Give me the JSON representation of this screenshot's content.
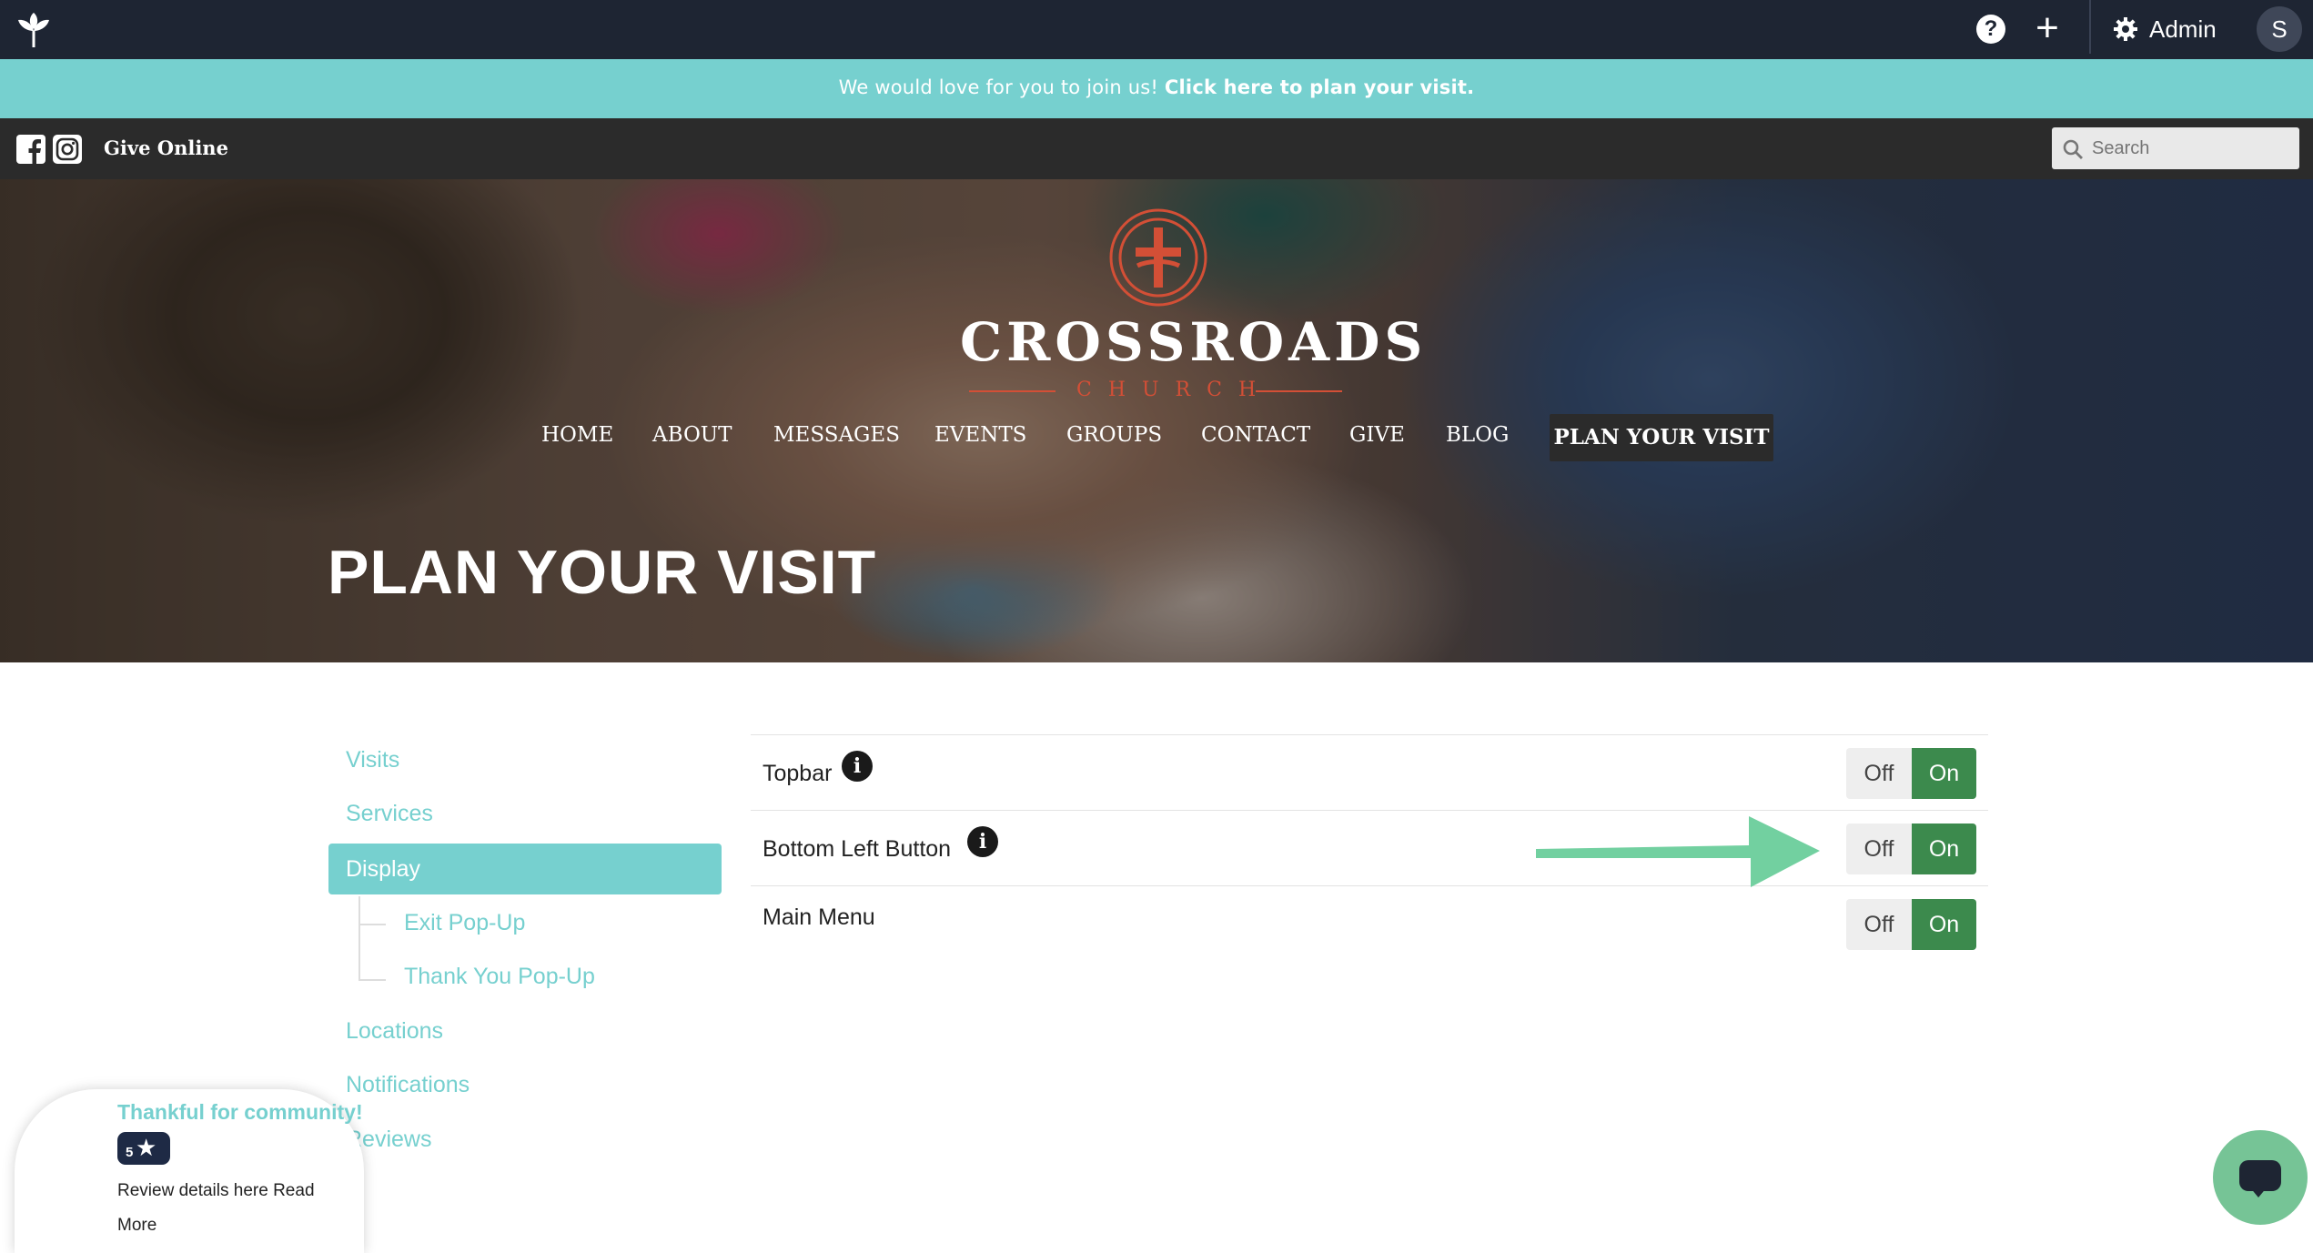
{
  "admin_bar": {
    "logo_icon": "leaf-logo-icon",
    "help_icon_glyph": "?",
    "add_icon_glyph": "+",
    "settings_icon": "gear-icon",
    "admin_label": "Admin",
    "avatar_initial": "S"
  },
  "announcement": {
    "text": "We would love for you to join us!",
    "link_text": "Click here to plan your visit.",
    "bg_color": "#76d0cf"
  },
  "utility_bar": {
    "social_icons": [
      "facebook-icon",
      "instagram-icon"
    ],
    "give_label": "Give Online",
    "search_placeholder": "Search"
  },
  "brand": {
    "name": "CROSSROADS",
    "subname": "CHURCH",
    "accent_color": "#d34f36"
  },
  "main_nav": {
    "items": [
      "HOME",
      "ABOUT",
      "MESSAGES",
      "EVENTS",
      "GROUPS",
      "CONTACT",
      "GIVE",
      "BLOG"
    ],
    "cta": "PLAN YOUR VISIT"
  },
  "page": {
    "title": "PLAN YOUR VISIT"
  },
  "side_nav": {
    "items": [
      "Visits",
      "Services",
      "Display",
      "Locations",
      "Notifications",
      "Reviews"
    ],
    "active": "Display",
    "sub_items": [
      "Exit Pop-Up",
      "Thank You Pop-Up"
    ],
    "accent_color": "#76d0cf"
  },
  "settings": {
    "rows": [
      {
        "label": "Topbar",
        "has_info": true,
        "off_label": "Off",
        "on_label": "On",
        "value": "On"
      },
      {
        "label": "Bottom Left Button",
        "has_info": true,
        "off_label": "Off",
        "on_label": "On",
        "value": "On"
      },
      {
        "label": "Main Menu",
        "has_info": false,
        "off_label": "Off",
        "on_label": "On",
        "value": "On"
      }
    ],
    "on_color": "#3c8a4d",
    "info_glyph": "i"
  },
  "review_widget": {
    "title": "Thankful for community!",
    "rating": "5",
    "text_line1": "Review details here Read",
    "text_line2": "More"
  },
  "chat_widget": {
    "icon": "chat-bubble-icon",
    "color": "#76c496"
  }
}
